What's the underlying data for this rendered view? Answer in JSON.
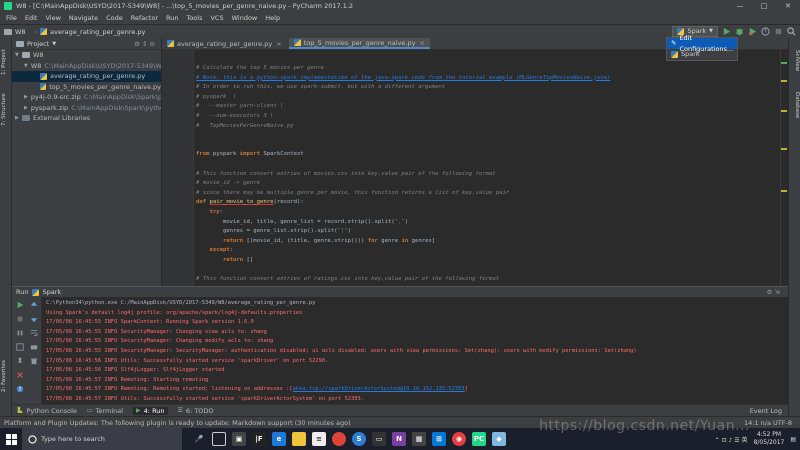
{
  "window": {
    "title": "W8 - [C:\\MainAppDisk\\USYD\\2017-5349\\W8] - ...\\top_5_movies_per_genre_naive.py - PyCharm 2017.1.2",
    "controls": [
      "—",
      "□",
      "✕"
    ]
  },
  "menu": [
    "File",
    "Edit",
    "View",
    "Navigate",
    "Code",
    "Refactor",
    "Run",
    "Tools",
    "VCS",
    "Window",
    "Help"
  ],
  "nav": {
    "project": "W8",
    "file": "average_rating_per_genre.py"
  },
  "run_config": {
    "label": "Spark",
    "menu": [
      "Edit Configurations...",
      "Spark"
    ]
  },
  "left_tabs": [
    "1: Project",
    "7: Structure",
    "2: Favorites"
  ],
  "right_tabs": [
    "SciView",
    "Database"
  ],
  "project": {
    "header": "Project",
    "tree": [
      {
        "indent": 0,
        "arrow": "▼",
        "icon": "folder",
        "name": "W8",
        "path": ""
      },
      {
        "indent": 1,
        "arrow": "▼",
        "icon": "folder",
        "name": "W8",
        "path": "C:\\MainAppDisk\\USYD\\2017-5349\\W8"
      },
      {
        "indent": 2,
        "arrow": "",
        "icon": "py",
        "name": "average_rating_per_genre.py",
        "path": "",
        "selected": true
      },
      {
        "indent": 2,
        "arrow": "",
        "icon": "py",
        "name": "top_5_movies_per_genre_naive.py",
        "path": ""
      },
      {
        "indent": 1,
        "arrow": "▶",
        "icon": "folder",
        "name": "py4j-0.9-src.zip",
        "path": "C:\\MainAppDisk\\Spark\\py"
      },
      {
        "indent": 1,
        "arrow": "▶",
        "icon": "folder",
        "name": "pyspark.zip",
        "path": "C:\\MainAppDisk\\Spark\\pytho"
      },
      {
        "indent": 0,
        "arrow": "▶",
        "icon": "lib",
        "name": "External Libraries",
        "path": ""
      }
    ]
  },
  "tabs": [
    {
      "label": "average_rating_per_genre.py",
      "active": false
    },
    {
      "label": "top_5_movies_per_genre_naive.py",
      "active": true
    }
  ],
  "code": [
    {
      "cls": "c-comment",
      "text": "# Calculate the top 5 movies per genre"
    },
    {
      "cls": "c-link",
      "text": "# Note: this is a python-spark implementation of the java-spark code from the tutorial example (MLGenreTopMoviesNaive.java)"
    },
    {
      "cls": "c-comment",
      "text": "# In order to run this, we use spark-submit, but with a different argument"
    },
    {
      "cls": "c-comment",
      "text": "# pyspark  \\"
    },
    {
      "cls": "c-comment",
      "text": "#   --master yarn-client \\"
    },
    {
      "cls": "c-comment",
      "text": "#   --num-executors 3 \\"
    },
    {
      "cls": "c-comment",
      "text": "#   TopMoviesPerGenreNaive.py"
    },
    {
      "cls": "c-plain",
      "text": ""
    },
    {
      "cls": "c-plain",
      "text": ""
    },
    {
      "cls": "import",
      "text": "from pyspark import SparkContext"
    },
    {
      "cls": "c-plain",
      "text": ""
    },
    {
      "cls": "c-comment",
      "text": "# This function convert entries of movies.csv into key,value pair of the following format"
    },
    {
      "cls": "c-comment",
      "text": "# movie_id -> genre"
    },
    {
      "cls": "c-comment",
      "text": "# since there may be multiple genre per movie, this function returns a list of key,value pair"
    },
    {
      "cls": "def",
      "text": "def pair_movie_to_genre(record):"
    },
    {
      "cls": "try",
      "text": "    try:"
    },
    {
      "cls": "c-plain",
      "text": "        movie_id, title, genre_list = record.strip().split(\",\")"
    },
    {
      "cls": "c-plain",
      "text": "        genres = genre_list.strip().split(\"|\")"
    },
    {
      "cls": "ret",
      "text": "        return [(movie_id, (title, genre.strip())) for genre in genres]"
    },
    {
      "cls": "exc",
      "text": "    except:"
    },
    {
      "cls": "ret2",
      "text": "        return []"
    },
    {
      "cls": "c-plain",
      "text": ""
    },
    {
      "cls": "c-comment",
      "text": "# This function convert entries of ratings.csv into key,value pair of the following format"
    },
    {
      "cls": "c-comment",
      "text": "# movie_id -> 1"
    }
  ],
  "run": {
    "header": "Run",
    "config": "Spark",
    "lines": [
      {
        "cls": "con-cmd",
        "text": "C:\\Python34\\python.exe C:/MainAppDisk/USYD/2017-5349/W8/average_rating_per_genre.py"
      },
      {
        "cls": "con-err",
        "text": "Using Spark's default log4j profile: org/apache/spark/log4j-defaults.properties"
      },
      {
        "cls": "con-err",
        "text": "17/05/08 16:45:55 INFO SparkContext: Running Spark version 1.6.0"
      },
      {
        "cls": "con-err",
        "text": "17/05/08 16:45:55 INFO SecurityManager: Changing view acls to: zhang"
      },
      {
        "cls": "con-err",
        "text": "17/05/08 16:45:55 INFO SecurityManager: Changing modify acls to: zhang"
      },
      {
        "cls": "con-err",
        "text": "17/05/08 16:45:55 INFO SecurityManager: SecurityManager: authentication disabled; ui acls disabled; users with view permissions: Set(zhang); users with modify permissions: Set(zhang)"
      },
      {
        "cls": "con-err",
        "text": "17/05/08 16:45:56 INFO Utils: Successfully started service 'sparkDriver' on port 52290."
      },
      {
        "cls": "con-err",
        "text": "17/05/08 16:45:56 INFO Slf4jLogger: Slf4jLogger started"
      },
      {
        "cls": "con-err",
        "text": "17/05/08 16:45:57 INFO Remoting: Starting remoting"
      },
      {
        "cls": "con-err-link",
        "text": "17/05/08 16:45:57 INFO Remoting: Remoting started; listening on addresses :[akka.tcp://sparkDriverActorSystem@10.16.152.135:52303]"
      },
      {
        "cls": "con-err",
        "text": "17/05/08 16:45:57 INFO Utils: Successfully started service 'sparkDriverActorSystem' on port 52303."
      }
    ]
  },
  "bottom_tabs": [
    {
      "label": "Python Console",
      "active": false
    },
    {
      "label": "Terminal",
      "active": false
    },
    {
      "label": "4: Run",
      "active": true
    },
    {
      "label": "6: TODO",
      "active": false
    }
  ],
  "event_log": "Event Log",
  "status": {
    "message": "Platform and Plugin Updates: The following plugin is ready to update: Markdown support (30 minutes ago)",
    "position": "14:1  n/a  UTF-8"
  },
  "watermark": "https://blog.csdn.net/Yuan...",
  "taskbar": {
    "search_placeholder": "Type here to search",
    "time": "4:52 PM",
    "date": "8/05/2017"
  },
  "colors": {
    "accent": "#4a88c7",
    "selection": "#0d5bb5",
    "error": "#ff6b68"
  }
}
